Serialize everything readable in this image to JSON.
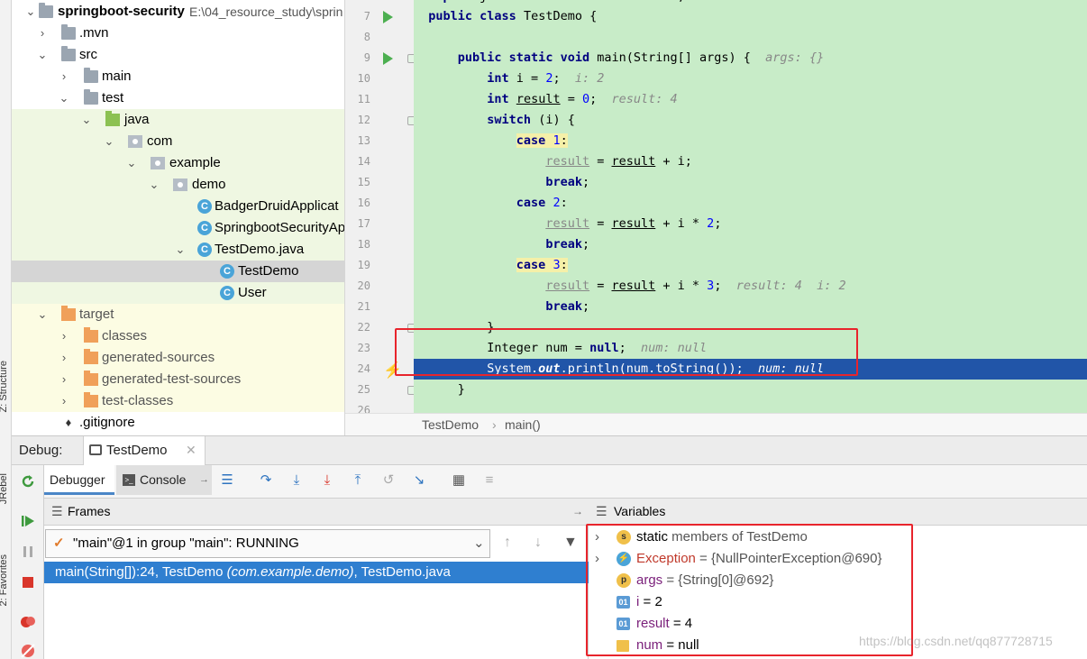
{
  "side_tabs": {
    "structure": "Z: Structure",
    "jrebel": "JRebel",
    "favorites": "2: Favorites"
  },
  "project": {
    "root_name": "springboot-security",
    "root_path": "E:\\04_resource_study\\sprin",
    "items": [
      {
        "label": ".mvn"
      },
      {
        "label": "src"
      },
      {
        "label": "main"
      },
      {
        "label": "test"
      },
      {
        "label": "java"
      },
      {
        "label": "com"
      },
      {
        "label": "example"
      },
      {
        "label": "demo"
      },
      {
        "label": "BadgerDruidApplicat"
      },
      {
        "label": "SpringbootSecurityAp"
      },
      {
        "label": "TestDemo.java"
      },
      {
        "label": "TestDemo"
      },
      {
        "label": "User"
      },
      {
        "label": "target"
      },
      {
        "label": "classes"
      },
      {
        "label": "generated-sources"
      },
      {
        "label": "generated-test-sources"
      },
      {
        "label": "test-classes"
      },
      {
        "label": ".gitignore"
      }
    ]
  },
  "editor": {
    "line_numbers": [
      "7",
      "8",
      "9",
      "10",
      "11",
      "12",
      "13",
      "14",
      "15",
      "16",
      "17",
      "18",
      "19",
      "20",
      "21",
      "22",
      "23",
      "24",
      "25",
      "26"
    ],
    "hints": {
      "args": "args: {}",
      "i": "i: 2",
      "result": "result: 4",
      "result_i": "result: 4  i: 2",
      "num": "num: null",
      "num2": "num: null"
    },
    "breadcrumb": [
      "TestDemo",
      "main()"
    ]
  },
  "debug": {
    "label": "Debug:",
    "session_tab": "TestDemo",
    "tabs": {
      "debugger": "Debugger",
      "console": "Console"
    },
    "frames_title": "Frames",
    "thread": "\"main\"@1 in group \"main\": RUNNING",
    "frame": {
      "method": "main(String[]):24, TestDemo ",
      "pkg": "(com.example.demo)",
      "file": ", TestDemo.java"
    },
    "variables_title": "Variables",
    "variables": [
      {
        "name": "static",
        "value": " members of TestDemo"
      },
      {
        "name": "Exception",
        "value": " = {NullPointerException@690}"
      },
      {
        "name": "args",
        "value": " = {String[0]@692}"
      },
      {
        "name": "i",
        "value": " = 2"
      },
      {
        "name": "result",
        "value": " = 4"
      },
      {
        "name": "num",
        "value": " = null"
      }
    ]
  },
  "watermark": "https://blog.csdn.net/qq877728715",
  "colors": {
    "accent_red": "#e8242c",
    "exec_line": "#2155a8",
    "selected_frame": "#2f7fd0"
  }
}
